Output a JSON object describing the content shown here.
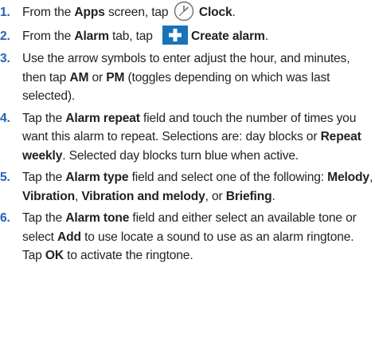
{
  "icons": {
    "clock": "clock-icon",
    "plus": "plus-icon"
  },
  "colors": {
    "number": "#1f64b4",
    "plus_tile": "#1a73b8",
    "text": "#231f20"
  },
  "steps": [
    {
      "number": "1.",
      "parts": [
        "From the ",
        "Apps",
        " screen, tap ",
        "Clock",
        "."
      ]
    },
    {
      "number": "2.",
      "parts": [
        "From the ",
        "Alarm",
        " tab, tap ",
        "Create alarm",
        "."
      ]
    },
    {
      "number": "3.",
      "parts": [
        "Use the arrow symbols to enter adjust the hour, and minutes, then tap ",
        "AM",
        " or ",
        "PM",
        " (toggles depending on which was last selected)."
      ]
    },
    {
      "number": "4.",
      "parts": [
        "Tap the ",
        "Alarm repeat",
        " field and touch the number of times you want this alarm to repeat. Selections are: day blocks or ",
        "Repeat weekly",
        ". Selected day blocks turn blue when active."
      ]
    },
    {
      "number": "5.",
      "parts": [
        "Tap the ",
        "Alarm type",
        " field and select one of the following: ",
        "Melody",
        ", ",
        "Vibration",
        ", ",
        "Vibration and melody",
        ", or ",
        "Briefing",
        "."
      ]
    },
    {
      "number": "6.",
      "parts": [
        "Tap the ",
        "Alarm tone",
        " field and either select an available tone or select ",
        "Add",
        " to use locate a sound to use as an alarm ringtone. Tap ",
        "OK",
        " to activate the ringtone."
      ]
    }
  ]
}
